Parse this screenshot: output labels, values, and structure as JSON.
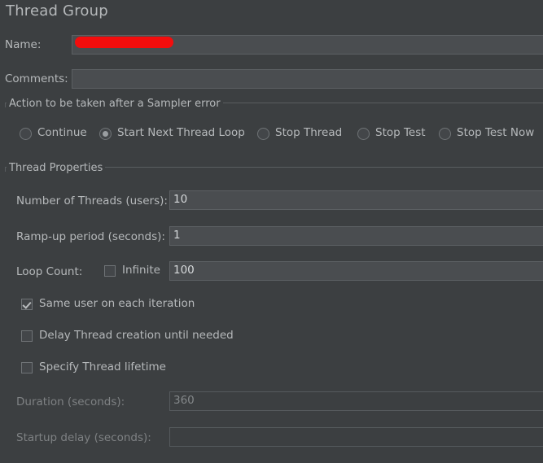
{
  "panel": {
    "title": "Thread Group"
  },
  "name_row": {
    "label": "Name:",
    "value": "",
    "redacted": true
  },
  "comments_row": {
    "label": "Comments:",
    "value": ""
  },
  "sampler_error_group": {
    "title": "Action to be taken after a Sampler error",
    "options": [
      {
        "label": "Continue",
        "selected": false
      },
      {
        "label": "Start Next Thread Loop",
        "selected": true
      },
      {
        "label": "Stop Thread",
        "selected": false
      },
      {
        "label": "Stop Test",
        "selected": false
      },
      {
        "label": "Stop Test Now",
        "selected": false
      }
    ]
  },
  "thread_properties": {
    "title": "Thread Properties",
    "number_of_threads": {
      "label": "Number of Threads (users):",
      "value": "10"
    },
    "ramp_up": {
      "label": "Ramp-up period (seconds):",
      "value": "1"
    },
    "loop_count": {
      "label": "Loop Count:",
      "infinite_label": "Infinite",
      "infinite_checked": false,
      "value": "100"
    },
    "checkboxes": [
      {
        "label": "Same user on each iteration",
        "checked": true
      },
      {
        "label": "Delay Thread creation until needed",
        "checked": false
      },
      {
        "label": "Specify Thread lifetime",
        "checked": false
      }
    ],
    "duration": {
      "label": "Duration (seconds):",
      "value": "360",
      "disabled": true
    },
    "startup_delay": {
      "label": "Startup delay (seconds):",
      "value": "",
      "disabled": true
    }
  },
  "colors": {
    "background": "#3c3f41",
    "field_background": "#4a4d50",
    "field_border": "#5c6063",
    "text": "#b6b9bb",
    "text_disabled": "#7e8183",
    "redaction": "#f30d0d"
  }
}
